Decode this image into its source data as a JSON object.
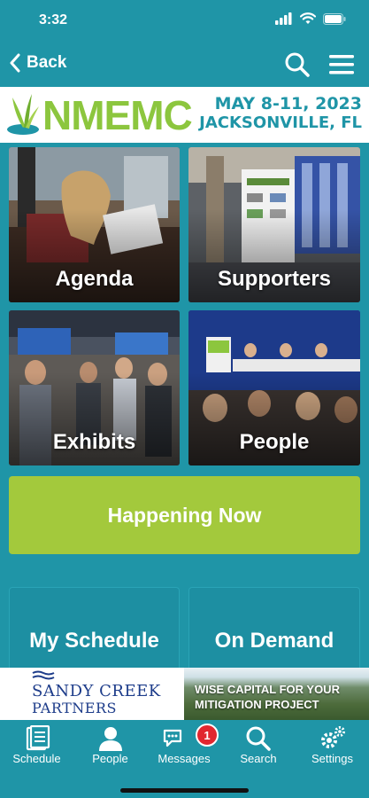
{
  "status_bar": {
    "time": "3:32"
  },
  "nav": {
    "back_label": "Back"
  },
  "banner": {
    "logo_text": "NMEMC",
    "date_line": "MAY 8-11, 2023",
    "location_line": "JACKSONVILLE, FL"
  },
  "tiles": [
    {
      "label": "Agenda"
    },
    {
      "label": "Supporters"
    },
    {
      "label": "Exhibits"
    },
    {
      "label": "People"
    }
  ],
  "happening_now": {
    "label": "Happening Now"
  },
  "lower_tiles": [
    {
      "label": "My Schedule"
    },
    {
      "label": "On Demand"
    }
  ],
  "ads": {
    "left": {
      "line1": "SANDY CREEK",
      "line2": "PARTNERS"
    },
    "right": {
      "line1": "WISE CAPITAL FOR YOUR",
      "line2": "MITIGATION PROJECT"
    }
  },
  "tab_bar": {
    "tabs": [
      {
        "label": "Schedule",
        "icon": "schedule-icon"
      },
      {
        "label": "People",
        "icon": "person-icon"
      },
      {
        "label": "Messages",
        "icon": "chat-icon",
        "badge": "1"
      },
      {
        "label": "Search",
        "icon": "search-icon"
      },
      {
        "label": "Settings",
        "icon": "gears-icon"
      }
    ]
  },
  "colors": {
    "primary": "#1f95a7",
    "accent_green": "#a3c93c",
    "logo_green": "#8cc63e",
    "badge_red": "#e1262f"
  }
}
